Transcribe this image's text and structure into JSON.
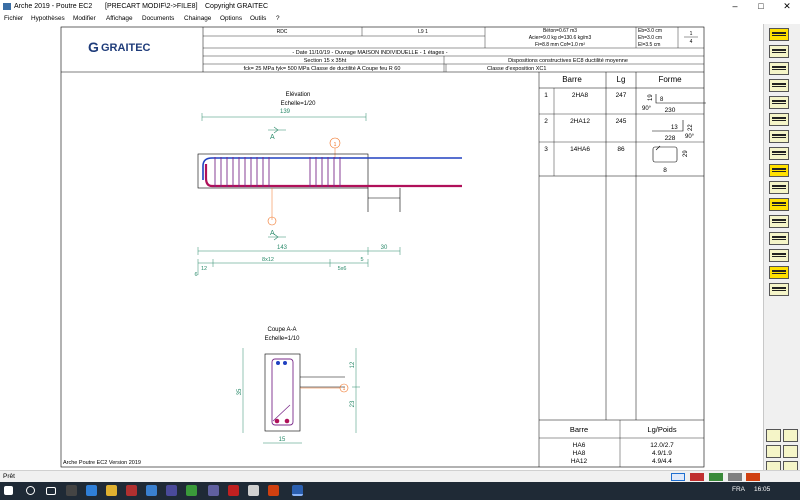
{
  "window": {
    "title": "Arche 2019 - Poutre EC2",
    "document_path": "[PRECART MODIF\\2->FILE8]",
    "copyright": "Copyright GRAITEC",
    "controls": {
      "minimize": "–",
      "maximize": "□",
      "close": "✕"
    }
  },
  "menu": [
    "Fichier",
    "Hypothèses",
    "Modifier",
    "Affichage",
    "Documents",
    "Chainage",
    "Options",
    "Outils",
    "?"
  ],
  "header": {
    "logo_text": "GRAITEC",
    "level": "RDC",
    "element": "L9 1",
    "materials": [
      "Béton=0.67 m3",
      "Acier=9.0 kg d=130.6 kg/m3",
      "Fi=8.8 mm Cof=1.0 m²"
    ],
    "covers": [
      "Eb=3.0 cm",
      "Eh=3.0 cm",
      "El=3.5 cm"
    ],
    "sheet": {
      "num": "1",
      "total": "4"
    },
    "date_line": "- Date 11/10/19 - Ouvrage MAISON INDIVIDUELLE - 1 étages -",
    "section_line": "Section     15 x  35ht",
    "dispositions": "Dispositions constructives EC8  ductilité moyenne",
    "steel_line": "fck=  25 MPa fyk=  500 MPa  Classe de ductilité A Coupe feu R 60",
    "exposure": "Classe d'exposition  XC1"
  },
  "elevation": {
    "title": "Elévation",
    "scale": "Echelle=1/20",
    "dim_top": "139",
    "section_mark": "A",
    "dim_bottom1": "143",
    "dim_bottom2": "30",
    "spacing_left": "12",
    "spacing_main": "8x12",
    "spacing_end": "5",
    "spacing_right": "5x6",
    "spacing_origin": "6",
    "callout": "1"
  },
  "section_cut": {
    "title": "Coupe A-A",
    "scale": "Echelle=1/10",
    "height": "35",
    "top_dim": "12",
    "bottom_dim": "23",
    "width": "15",
    "callout": "1"
  },
  "bar_table": {
    "headers": [
      "Barre",
      "Lg",
      "Forme"
    ],
    "rows": [
      {
        "num": "1",
        "bar": "2HA8",
        "length": "247",
        "shape_a": "19",
        "shape_b": "8",
        "shape_c": "230",
        "angle": "90°"
      },
      {
        "num": "2",
        "bar": "2HA12",
        "length": "245",
        "shape_a": "13",
        "shape_b": "22",
        "shape_c": "228",
        "angle": "90°"
      },
      {
        "num": "3",
        "bar": "14HA6",
        "length": "86",
        "shape_a": "29",
        "shape_b": "8"
      }
    ]
  },
  "weight_table": {
    "headers": [
      "Barre",
      "Lg/Poids"
    ],
    "rows": [
      {
        "bar": "HA6",
        "value": "12.0/2.7"
      },
      {
        "bar": "HA8",
        "value": "4.9/1.9"
      },
      {
        "bar": "HA12",
        "value": "4.9/4.4"
      }
    ]
  },
  "footer": {
    "version": "Arche Poutre EC2 Version 2019"
  },
  "status": {
    "text": "Prêt"
  },
  "taskbar": {
    "language": "FRA",
    "time": "16:05"
  },
  "colors": {
    "stirrup": "#7a2a8a",
    "top_bar": "#2040c0",
    "bottom_bar": "#b0105a",
    "dimension": "#2a8a6a",
    "highlight": "#f07020",
    "sheet_line": "#000000",
    "toolbar_selected": "#ffe000"
  }
}
